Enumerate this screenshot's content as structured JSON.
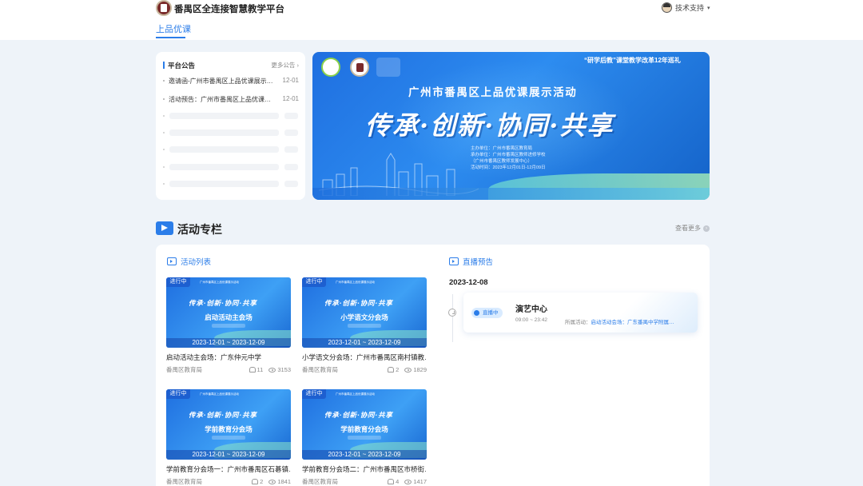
{
  "header": {
    "site_title": "番禺区全连接智慧教学平台",
    "support_label": "技术支持",
    "caret": "▾",
    "nav_tab": "上品优课"
  },
  "notice": {
    "title": "平台公告",
    "more": "更多公告 ›",
    "items": [
      {
        "text": "邀请函-广州市番禺区上品优课展示…",
        "date": "12-01"
      },
      {
        "text": "活动预告：广州市番禺区上品优课…",
        "date": "12-01"
      }
    ]
  },
  "banner": {
    "tag": "“研学后教”课堂教学改革12年巡礼",
    "title": "广州市番禺区上品优课展示活动",
    "slogan": "传承·创新·协同·共享",
    "info_lines": [
      "主办单位：广州市番禺区教育局",
      "承办单位：广州市番禺区教师进修学校",
      "（广州市番禺区教师发展中心）",
      "活动时间：2023年12月01日-12月09日"
    ]
  },
  "section": {
    "title": "活动专栏",
    "more": "查看更多",
    "more_icon": "›"
  },
  "activity_list": {
    "title": "活动列表",
    "cards": [
      {
        "status": "进行中",
        "head": "广州市番禺区上品优课展示活动",
        "slogan": "传承·创新·协同·共享",
        "venue": "启动活动主会场",
        "date_range": "2023-12-01 ~ 2023-12-09",
        "name": "启动活动主会场：广东仲元中学",
        "org": "番禺区教育局",
        "participants": "11",
        "views": "3153"
      },
      {
        "status": "进行中",
        "head": "广州市番禺区上品优课展示活动",
        "slogan": "传承·创新·协同·共享",
        "venue": "小学语文分会场",
        "date_range": "2023-12-01 ~ 2023-12-09",
        "name": "小学语文分会场：广州市番禺区南村镇教…",
        "org": "番禺区教育局",
        "participants": "2",
        "views": "1829"
      },
      {
        "status": "进行中",
        "head": "广州市番禺区上品优课展示活动",
        "slogan": "传承·创新·协同·共享",
        "venue": "学前教育分会场",
        "date_range": "2023-12-01 ~ 2023-12-09",
        "name": "学前教育分会场一：广州市番禺区石碁镇…",
        "org": "番禺区教育局",
        "participants": "2",
        "views": "1841"
      },
      {
        "status": "进行中",
        "head": "广州市番禺区上品优课展示活动",
        "slogan": "传承·创新·协同·共享",
        "venue": "学前教育分会场",
        "date_range": "2023-12-01 ~ 2023-12-09",
        "name": "学前教育分会场二：广州市番禺区市桥街…",
        "org": "番禺区教育局",
        "participants": "4",
        "views": "1417"
      }
    ]
  },
  "live_preview": {
    "title": "直播预告",
    "date": "2023-12-08",
    "item": {
      "badge": "直播中",
      "room": "演艺中心",
      "time": "09:00 ~ 23:42",
      "activity_label": "所属活动：",
      "activity_value": "启动活动会场：广东番禺中学附属…"
    }
  },
  "colors": {
    "accent": "#2b7de9",
    "page_bg": "#eef3f9"
  }
}
